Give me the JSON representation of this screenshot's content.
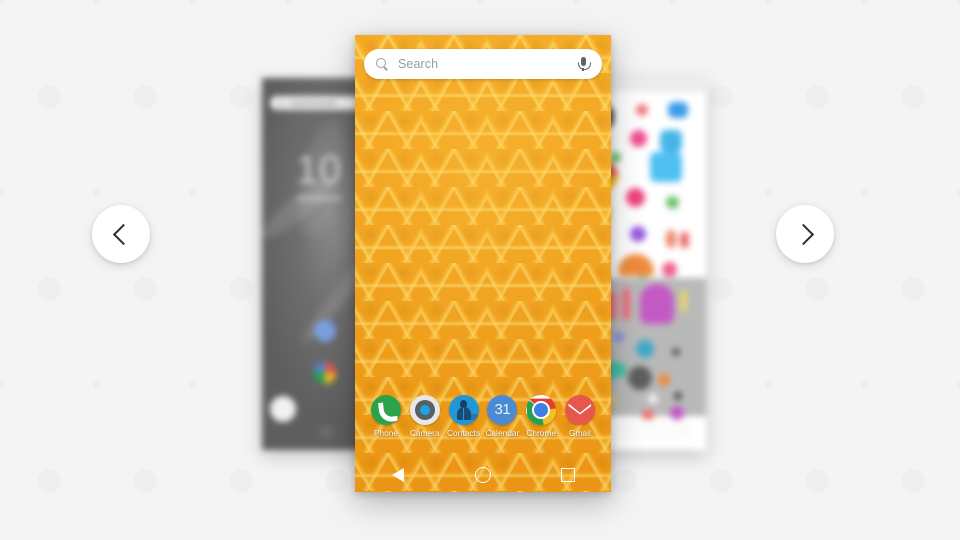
{
  "background": {
    "color": "#f4f4f4",
    "dot_color": "#efefef"
  },
  "carousel": {
    "prev_label": "‹",
    "prev_name": "chevron-left-icon",
    "next_label": "›",
    "next_name": "chevron-right-icon"
  },
  "preview_left": {
    "type": "home-screen-preview",
    "theme": "dark-gray",
    "clock": "10",
    "blurred": true
  },
  "preview_right": {
    "type": "app-drawer-preview",
    "theme": "light-white",
    "blurred": true
  },
  "phone": {
    "wallpaper_name": "honeycomb",
    "wallpaper_colors": {
      "base": "#f0a01c",
      "ridge": "#ffe480",
      "shadow": "#c4760a"
    },
    "search": {
      "placeholder": "Search",
      "value": "Search",
      "search_icon": "magnifier-icon",
      "mic_icon": "microphone-icon"
    },
    "dock": [
      {
        "id": "phone",
        "label": "Phone",
        "icon": "phone-icon",
        "color": "#2ca24a"
      },
      {
        "id": "camera",
        "label": "Camera",
        "icon": "camera-icon",
        "color": "#e8e8e8"
      },
      {
        "id": "contacts",
        "label": "Contacts",
        "icon": "contacts-icon",
        "color": "#2196d8"
      },
      {
        "id": "calendar",
        "label": "Calendar",
        "icon": "calendar-icon",
        "color": "#4a8bd4",
        "day": "31"
      },
      {
        "id": "chrome",
        "label": "Chrome",
        "icon": "chrome-icon",
        "color": "#3f7fe0"
      },
      {
        "id": "gmail",
        "label": "Gmail",
        "icon": "gmail-icon",
        "color": "#e8574c"
      }
    ],
    "navbar": [
      {
        "id": "back",
        "icon": "back-triangle-icon"
      },
      {
        "id": "home",
        "icon": "home-circle-icon"
      },
      {
        "id": "recents",
        "icon": "recents-square-icon"
      }
    ]
  }
}
